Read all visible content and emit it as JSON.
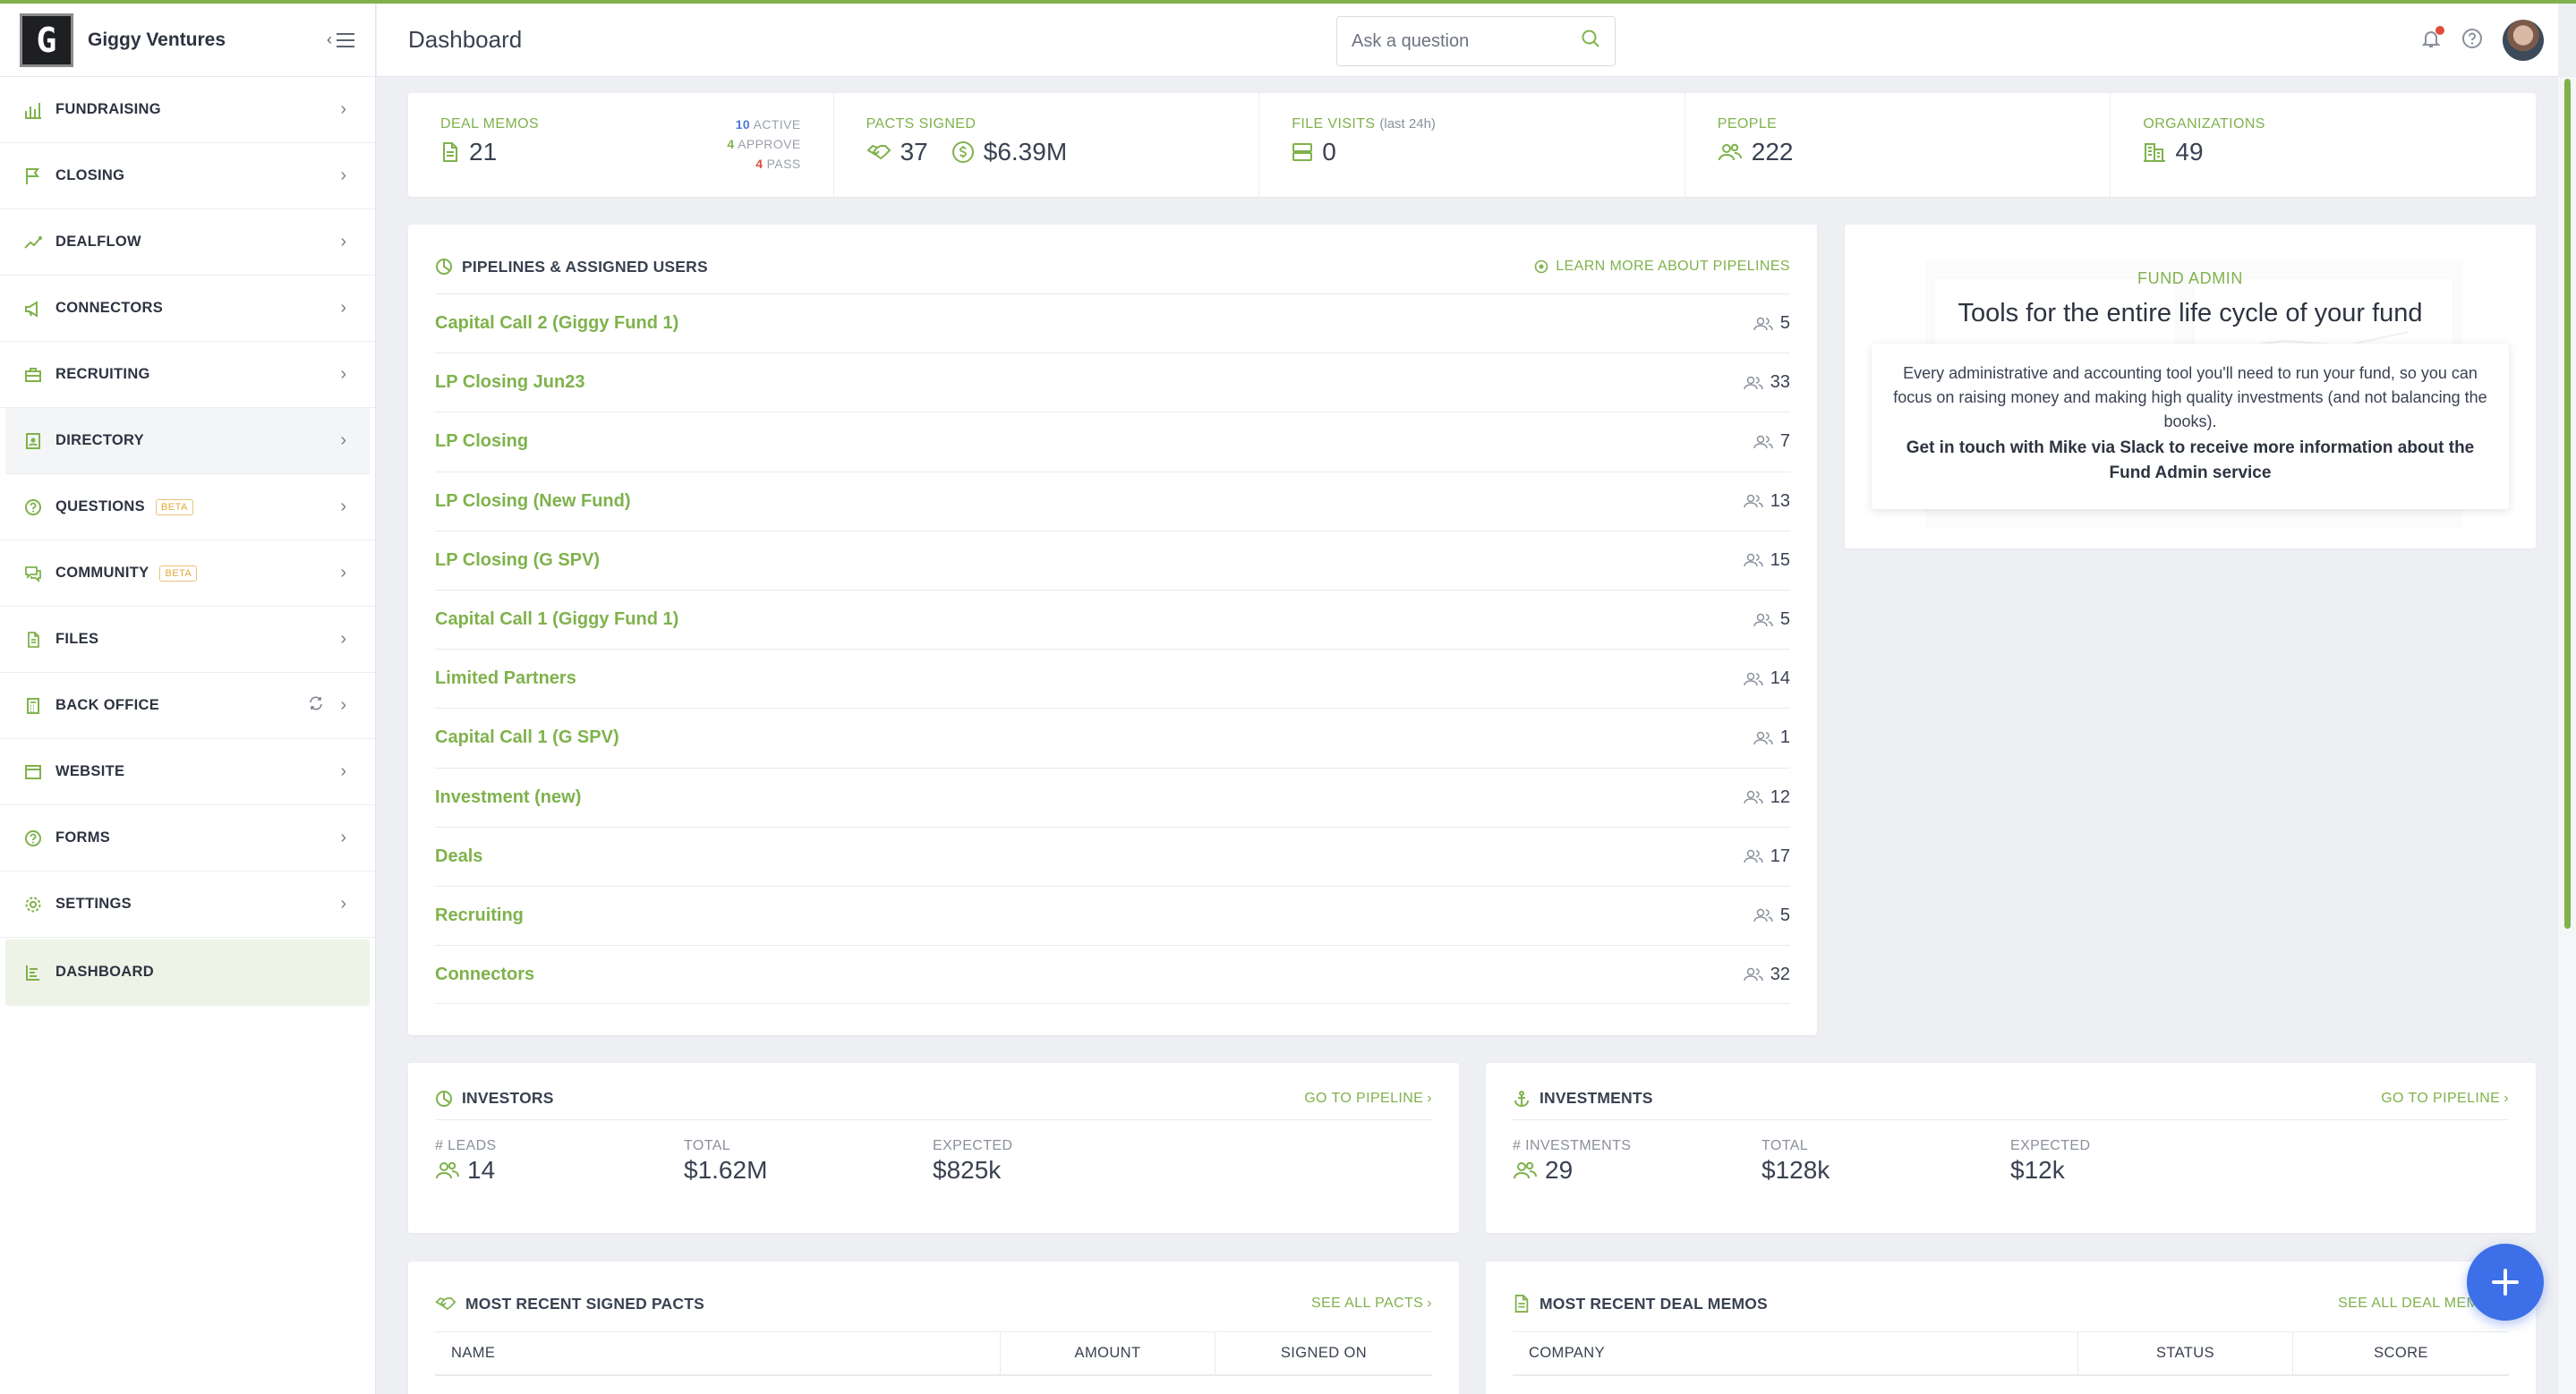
{
  "brand": {
    "name": "Giggy Ventures",
    "logo_letter": "G"
  },
  "sidebar": {
    "items": [
      {
        "label": "FUNDRAISING",
        "icon": "bar-chart-icon"
      },
      {
        "label": "CLOSING",
        "icon": "flag-icon"
      },
      {
        "label": "DEALFLOW",
        "icon": "trend-icon"
      },
      {
        "label": "CONNECTORS",
        "icon": "megaphone-icon"
      },
      {
        "label": "RECRUITING",
        "icon": "briefcase-icon"
      },
      {
        "label": "DIRECTORY",
        "icon": "address-book-icon"
      },
      {
        "label": "QUESTIONS",
        "icon": "question-icon",
        "badge": "BETA"
      },
      {
        "label": "COMMUNITY",
        "icon": "chat-icon",
        "badge": "BETA"
      },
      {
        "label": "FILES",
        "icon": "files-icon"
      },
      {
        "label": "BACK OFFICE",
        "icon": "calculator-icon"
      },
      {
        "label": "WEBSITE",
        "icon": "browser-icon"
      },
      {
        "label": "FORMS",
        "icon": "form-icon"
      },
      {
        "label": "SETTINGS",
        "icon": "gear-icon"
      },
      {
        "label": "DASHBOARD",
        "icon": "dashboard-icon"
      }
    ]
  },
  "header": {
    "title": "Dashboard",
    "search_placeholder": "Ask a question"
  },
  "stats": {
    "deal_memos": {
      "label": "DEAL MEMOS",
      "value": "21",
      "active": "10",
      "active_label": "ACTIVE",
      "approve": "4",
      "approve_label": "APPROVE",
      "pass": "4",
      "pass_label": "PASS"
    },
    "pacts": {
      "label": "PACTS SIGNED",
      "count": "37",
      "amount": "$6.39M"
    },
    "file_visits": {
      "label": "FILE VISITS",
      "sublabel": "(last 24h)",
      "value": "0"
    },
    "people": {
      "label": "PEOPLE",
      "value": "222"
    },
    "organizations": {
      "label": "ORGANIZATIONS",
      "value": "49"
    }
  },
  "pipelines": {
    "title": "PIPELINES & ASSIGNED USERS",
    "learn_more": "LEARN MORE ABOUT PIPELINES",
    "rows": [
      {
        "name": "Capital Call 2 (Giggy Fund 1)",
        "users": "5"
      },
      {
        "name": "LP Closing Jun23",
        "users": "33"
      },
      {
        "name": "LP Closing",
        "users": "7"
      },
      {
        "name": "LP Closing (New Fund)",
        "users": "13"
      },
      {
        "name": "LP Closing (G SPV)",
        "users": "15"
      },
      {
        "name": "Capital Call 1 (Giggy Fund 1)",
        "users": "5"
      },
      {
        "name": "Limited Partners",
        "users": "14"
      },
      {
        "name": "Capital Call 1 (G SPV)",
        "users": "1"
      },
      {
        "name": "Investment (new)",
        "users": "12"
      },
      {
        "name": "Deals",
        "users": "17"
      },
      {
        "name": "Recruiting",
        "users": "5"
      },
      {
        "name": "Connectors",
        "users": "32"
      }
    ]
  },
  "fund_admin": {
    "eyebrow": "FUND ADMIN",
    "title": "Tools for the entire life cycle of your fund",
    "description": "Every administrative and accounting tool you'll need to run your fund, so you can focus on raising money and making high quality investments (and not balancing the books).",
    "cta": "Get in touch with Mike via Slack to receive more information about the Fund Admin service"
  },
  "investors": {
    "title": "INVESTORS",
    "link": "GO TO PIPELINE",
    "leads_label": "# LEADS",
    "leads": "14",
    "total_label": "TOTAL",
    "total": "$1.62M",
    "expected_label": "EXPECTED",
    "expected": "$825k"
  },
  "investments": {
    "title": "INVESTMENTS",
    "link": "GO TO PIPELINE",
    "count_label": "# INVESTMENTS",
    "count": "29",
    "total_label": "TOTAL",
    "total": "$128k",
    "expected_label": "EXPECTED",
    "expected": "$12k"
  },
  "pacts_table": {
    "title": "MOST RECENT SIGNED PACTS",
    "link": "SEE ALL PACTS",
    "columns": [
      "NAME",
      "AMOUNT",
      "SIGNED ON"
    ]
  },
  "memos_table": {
    "title": "MOST RECENT DEAL MEMOS",
    "link": "SEE ALL DEAL MEMOS",
    "columns": [
      "COMPANY",
      "STATUS",
      "SCORE"
    ]
  },
  "colors": {
    "accent": "#7fb24c",
    "fab": "#3d6fe8",
    "pass": "#e24b3b",
    "active": "#4a7bd6"
  }
}
